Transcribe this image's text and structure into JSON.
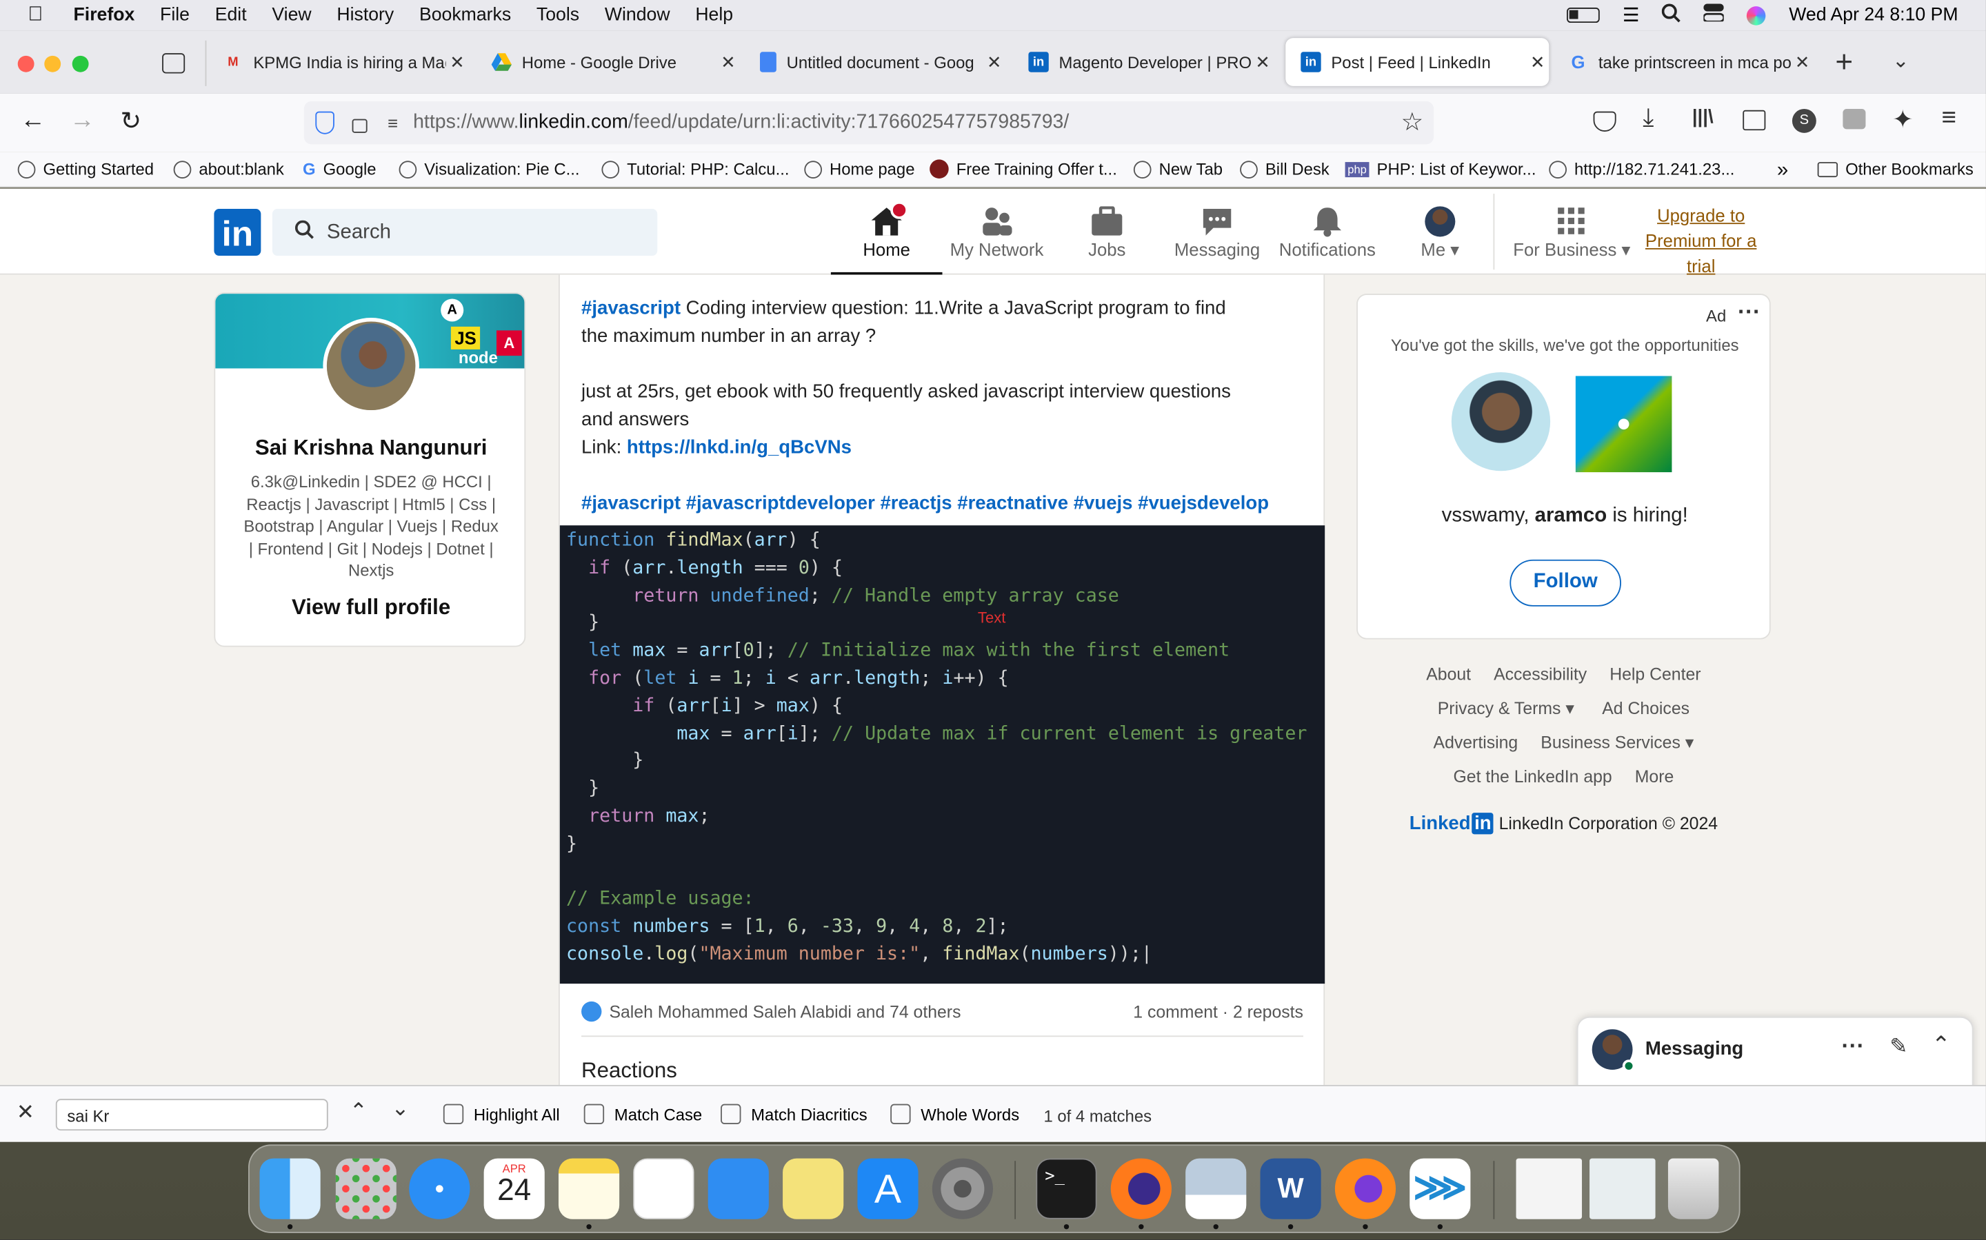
{
  "menubar": {
    "app": "Firefox",
    "items": [
      "File",
      "Edit",
      "View",
      "History",
      "Bookmarks",
      "Tools",
      "Window",
      "Help"
    ],
    "clock": "Wed Apr 24  8:10 PM"
  },
  "tabs": [
    {
      "title": "KPMG India is hiring a Mag",
      "icon": "gmail-icon"
    },
    {
      "title": "Home - Google Drive",
      "icon": "google-drive-icon"
    },
    {
      "title": "Untitled document - Goog",
      "icon": "google-docs-icon"
    },
    {
      "title": "Magento Developer | PRO",
      "icon": "linkedin-icon"
    },
    {
      "title": "Post | Feed | LinkedIn",
      "icon": "linkedin-icon"
    },
    {
      "title": "take printscreen in mca po",
      "icon": "google-icon"
    }
  ],
  "url": {
    "prefix": "https://www.",
    "domain": "linkedin.com",
    "path": "/feed/update/urn:li:activity:7176602547757985793/"
  },
  "bookmarks": [
    "Getting Started",
    "about:blank",
    "Google",
    "Visualization: Pie C...",
    "Tutorial: PHP: Calcu...",
    "Home page",
    "Free Training Offer t...",
    "New Tab",
    "Bill Desk",
    "PHP: List of Keywor...",
    "http://182.71.241.23...",
    "Other Bookmarks"
  ],
  "linkedin": {
    "logo": "in",
    "search_placeholder": "Search",
    "nav": [
      {
        "label": "Home"
      },
      {
        "label": "My Network"
      },
      {
        "label": "Jobs"
      },
      {
        "label": "Messaging"
      },
      {
        "label": "Notifications"
      },
      {
        "label": "Me"
      },
      {
        "label": "For Business"
      }
    ],
    "premium": [
      "Upgrade to",
      "Premium for a",
      "trial"
    ]
  },
  "profile": {
    "name": "Sai Krishna Nangunuri",
    "headline": [
      "6.3k@Linkedin | SDE2 @ HCCI |",
      "Reactjs | Javascript | Html5 | Css |",
      "Bootstrap | Angular | Vuejs | Redux",
      "| Frontend | Git | Nodejs | Dotnet |",
      "Nextjs"
    ],
    "view_profile": "View full profile",
    "banner_badges": [
      "A",
      "JS",
      "A",
      "node"
    ]
  },
  "post": {
    "hashtag1": "#javascript",
    "line1": " Coding interview question: 11.Write a JavaScript program to find",
    "line2": "the maximum number in an array ?",
    "line3": "just at 25rs, get ebook with 50 frequently asked javascript interview questions",
    "line4": "and answers",
    "link_label": "Link: ",
    "link": "https://lnkd.in/g_qBcVNs",
    "hashtags": "#javascript #javascriptdeveloper #reactjs #reactnative #vuejs #vuejsdevelop",
    "code_overlay": "Text",
    "reactors": "Saleh Mohammed Saleh Alabidi and 74 others",
    "stats": "1 comment · 2 reposts",
    "reactions_heading": "Reactions"
  },
  "ad": {
    "label": "Ad",
    "tagline": "You've got the skills, we've got the opportunities",
    "hiring_prefix": "vsswamy, ",
    "hiring_company": "aramco",
    "hiring_suffix": " is hiring!",
    "follow": "Follow"
  },
  "footer": {
    "row1": [
      "About",
      "Accessibility",
      "Help Center"
    ],
    "row2": [
      "Privacy & Terms",
      "Ad Choices"
    ],
    "row3": [
      "Advertising",
      "Business Services"
    ],
    "row4": [
      "Get the LinkedIn app",
      "More"
    ],
    "brand": "Linked",
    "copyright": "LinkedIn Corporation © 2024"
  },
  "messaging": {
    "title": "Messaging"
  },
  "findbar": {
    "query": "sai Kr",
    "options": [
      "Highlight All",
      "Match Case",
      "Match Diacritics",
      "Whole Words"
    ],
    "matches": "1 of 4 matches"
  },
  "dock": {
    "calendar_month": "APR",
    "calendar_day": "24"
  }
}
